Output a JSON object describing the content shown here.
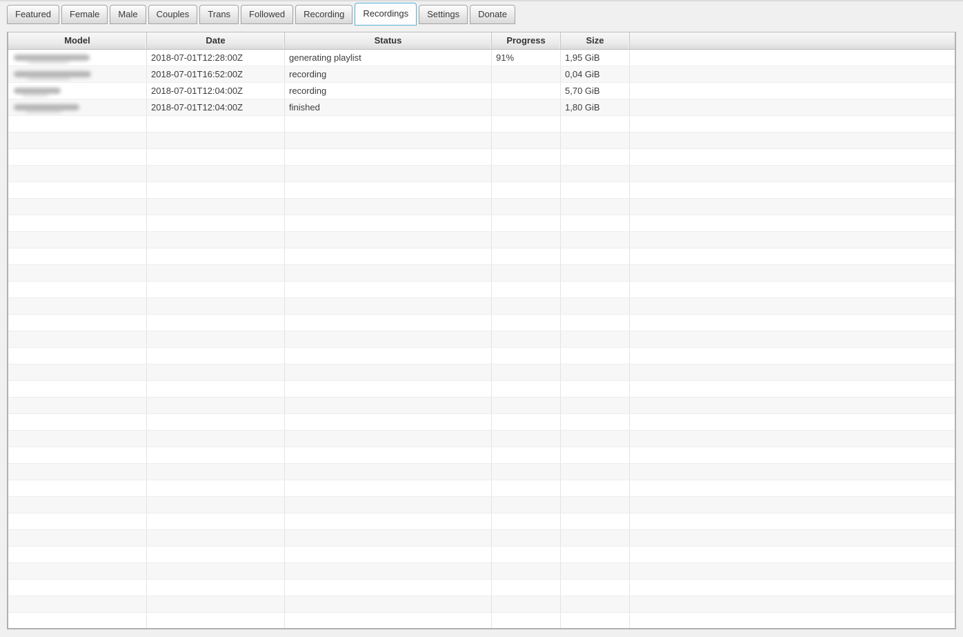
{
  "tabs": [
    {
      "id": "featured",
      "label": "Featured",
      "active": false
    },
    {
      "id": "female",
      "label": "Female",
      "active": false
    },
    {
      "id": "male",
      "label": "Male",
      "active": false
    },
    {
      "id": "couples",
      "label": "Couples",
      "active": false
    },
    {
      "id": "trans",
      "label": "Trans",
      "active": false
    },
    {
      "id": "followed",
      "label": "Followed",
      "active": false
    },
    {
      "id": "recording",
      "label": "Recording",
      "active": false
    },
    {
      "id": "recordings",
      "label": "Recordings",
      "active": true
    },
    {
      "id": "settings",
      "label": "Settings",
      "active": false
    },
    {
      "id": "donate",
      "label": "Donate",
      "active": false
    }
  ],
  "recordings_table": {
    "columns": [
      {
        "key": "model",
        "label": "Model"
      },
      {
        "key": "date",
        "label": "Date"
      },
      {
        "key": "status",
        "label": "Status"
      },
      {
        "key": "progress",
        "label": "Progress"
      },
      {
        "key": "size",
        "label": "Size"
      },
      {
        "key": "extra",
        "label": ""
      }
    ],
    "rows": [
      {
        "model_redacted": true,
        "redacted_blob_width": 110,
        "date": "2018-07-01T12:28:00Z",
        "status": "generating playlist",
        "progress": "91%",
        "size": "1,95 GiB",
        "extra": ""
      },
      {
        "model_redacted": true,
        "redacted_blob_width": 112,
        "date": "2018-07-01T16:52:00Z",
        "status": "recording",
        "progress": "",
        "size": "0,04 GiB",
        "extra": ""
      },
      {
        "model_redacted": true,
        "redacted_blob_width": 68,
        "date": "2018-07-01T12:04:00Z",
        "status": "recording",
        "progress": "",
        "size": "5,70 GiB",
        "extra": ""
      },
      {
        "model_redacted": true,
        "redacted_blob_width": 95,
        "date": "2018-07-01T12:04:00Z",
        "status": "finished",
        "progress": "",
        "size": "1,80 GiB",
        "extra": ""
      }
    ],
    "empty_rows": 31
  },
  "colors": {
    "accent_tab_active_border": "#56b0d8",
    "row_stripe": "#f7f7f7",
    "page_background": "#f0f0f0",
    "header_text": "#333333",
    "cell_text": "#3c3c3c"
  }
}
